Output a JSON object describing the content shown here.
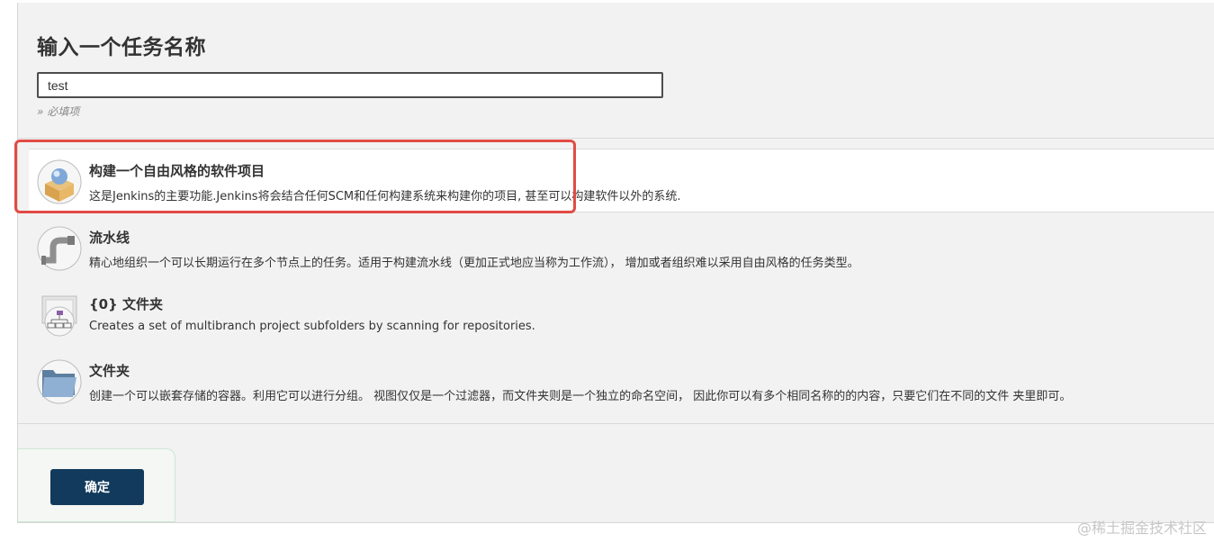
{
  "page": {
    "title": "输入一个任务名称",
    "name_input_value": "test",
    "required_hint": "» 必填项"
  },
  "items": [
    {
      "name": "构建一个自由风格的软件项目",
      "description": "这是Jenkins的主要功能.Jenkins将会结合任何SCM和任何构建系统来构建你的项目, 甚至可以构建软件以外的系统.",
      "icon": "freestyle-box-icon",
      "selected": true
    },
    {
      "name": "流水线",
      "description": "精心地组织一个可以长期运行在多个节点上的任务。适用于构建流水线（更加正式地应当称为工作流）， 增加或者组织难以采用自由风格的任务类型。",
      "icon": "pipeline-icon",
      "selected": false
    },
    {
      "name": "{0} 文件夹",
      "description": "Creates a set of multibranch project subfolders by scanning for repositories.",
      "icon": "multibranch-folder-icon",
      "selected": false
    },
    {
      "name": "文件夹",
      "description": "创建一个可以嵌套存储的容器。利用它可以进行分组。 视图仅仅是一个过滤器，而文件夹则是一个独立的命名空间， 因此你可以有多个相同名称的的内容，只要它们在不同的文件 夹里即可。",
      "icon": "folder-icon",
      "selected": false
    }
  ],
  "footer": {
    "ok_label": "确定"
  },
  "watermark": "@稀土掘金技术社区",
  "colors": {
    "highlight": "#e24b45",
    "ok_button": "#123a5c",
    "background": "#f2f2f2"
  }
}
